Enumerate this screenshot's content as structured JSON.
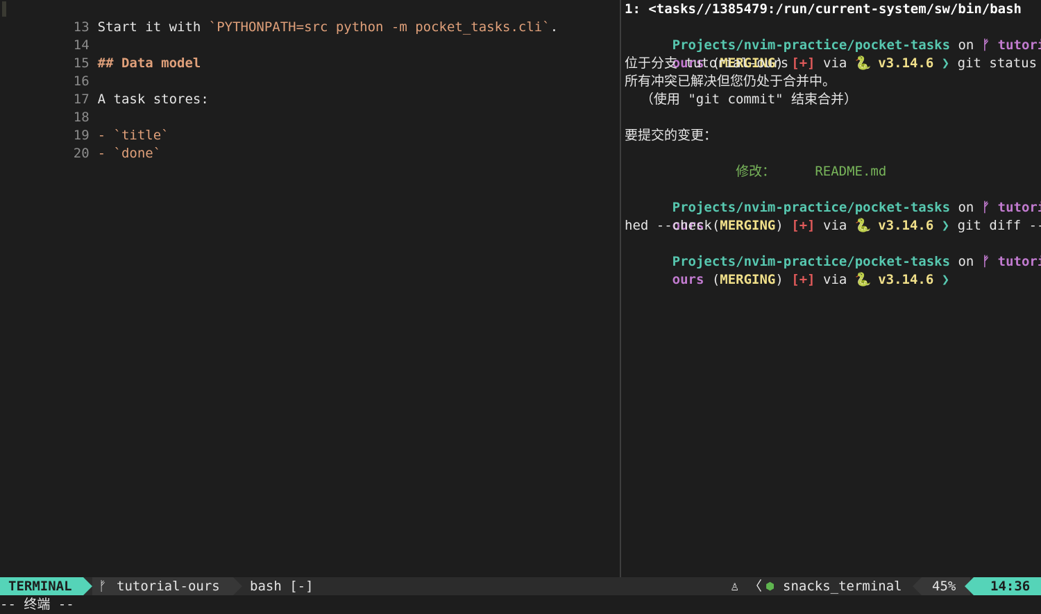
{
  "editor": {
    "lines": [
      {
        "num": "13",
        "segments": [
          {
            "text": "Start it with ",
            "style": "normal"
          },
          {
            "text": "`PYTHONPATH=src python -m pocket_tasks.cli`",
            "style": "code"
          },
          {
            "text": ".",
            "style": "normal"
          }
        ]
      },
      {
        "num": "14",
        "segments": []
      },
      {
        "num": "15",
        "segments": [
          {
            "text": "## Data model",
            "style": "head"
          }
        ]
      },
      {
        "num": "16",
        "segments": []
      },
      {
        "num": "17",
        "segments": [
          {
            "text": "A task stores:",
            "style": "normal"
          }
        ]
      },
      {
        "num": "18",
        "segments": []
      },
      {
        "num": "19",
        "segments": [
          {
            "text": "- ",
            "style": "bullet"
          },
          {
            "text": "`title`",
            "style": "code"
          }
        ]
      },
      {
        "num": "20",
        "segments": [
          {
            "text": "- ",
            "style": "bullet"
          },
          {
            "text": "`done`",
            "style": "code"
          }
        ]
      }
    ]
  },
  "terminal": {
    "title": "1: <tasks//1385479:/run/current-system/sw/bin/bash",
    "prompt": {
      "path": "Projects/nvim-practice/pocket-tasks",
      "on": " on ",
      "branch_icon": "ᚠ",
      "branch_part1": " tutorial-",
      "branch_part2": "ours",
      "merge_open": " (",
      "merge": "MERGING",
      "merge_close": ")",
      "plus": " [+]",
      "via": " via ",
      "version": " v3.14.6",
      "chevron": " ❯"
    },
    "cmd1": " git status",
    "status_lines": {
      "branch": "位于分支 tutorial-ours",
      "conflicts": "所有冲突已解决但您仍处于合并中。",
      "hint": "  （使用 \"git commit\" 结束合并）",
      "to_commit": "要提交的变更：",
      "modified_label": "        修改：     ",
      "modified_file": "README.md"
    },
    "cmd2_part1": " git diff --cac",
    "cmd2_part2": "hed --check"
  },
  "statusline": {
    "mode": "TERMINAL",
    "branch_icon": "ᚠ",
    "branch": "tutorial-ours",
    "file": "bash [-]",
    "os_icon": "♙",
    "sep": "〈",
    "ft_icon": "⬢",
    "filetype": "snacks_terminal",
    "percent": "45%",
    "time": "14:36"
  },
  "cmdline": "-- 终端 --",
  "colors": {
    "accent": "#55d4b8",
    "path": "#57c8b0",
    "branch": "#c27bd0",
    "merge": "#f1e08a",
    "plus": "#e05a5a",
    "markdown_code": "#e0a07a",
    "modified": "#78b55a",
    "background": "#1d1d1d"
  }
}
